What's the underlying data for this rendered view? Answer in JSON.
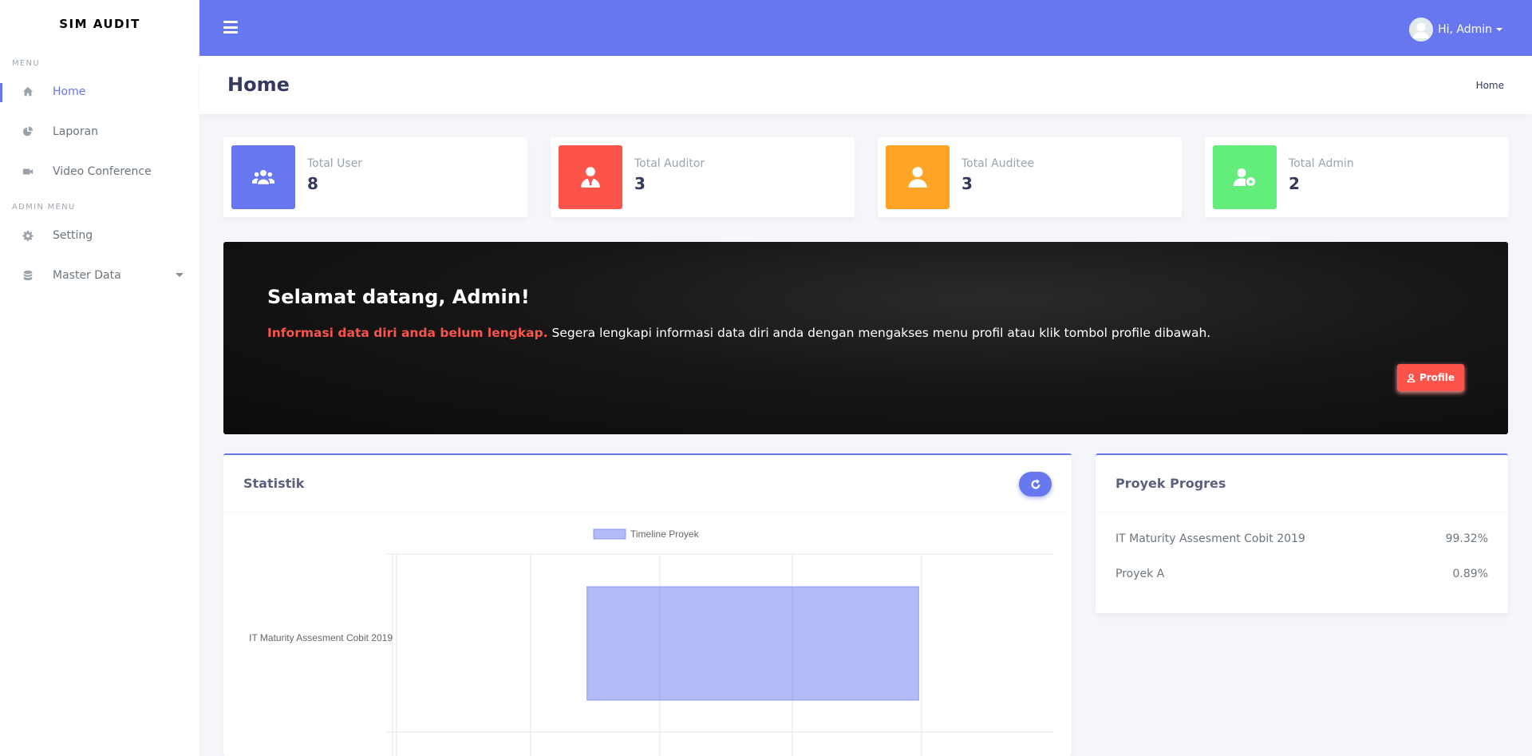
{
  "sidebar": {
    "brand": "SIM AUDIT",
    "menu_header": "MENU",
    "admin_menu_header": "ADMIN MENU",
    "items": [
      {
        "label": "Home",
        "icon": "home-icon"
      },
      {
        "label": "Laporan",
        "icon": "pie-chart-icon"
      },
      {
        "label": "Video Conference",
        "icon": "video-icon"
      },
      {
        "label": "Setting",
        "icon": "gear-icon"
      },
      {
        "label": "Master Data",
        "icon": "database-icon"
      }
    ]
  },
  "navbar": {
    "greeting": "Hi, Admin"
  },
  "section": {
    "title": "Home",
    "breadcrumb": "Home"
  },
  "stats": [
    {
      "label": "Total User",
      "value": "8",
      "color": "#6777ef",
      "icon": "users-icon"
    },
    {
      "label": "Total Auditor",
      "value": "3",
      "color": "#fc544b",
      "icon": "user-tie-icon"
    },
    {
      "label": "Total Auditee",
      "value": "3",
      "color": "#ffa426",
      "icon": "user-icon"
    },
    {
      "label": "Total Admin",
      "value": "2",
      "color": "#63ed7a",
      "icon": "user-cog-icon"
    }
  ],
  "hero": {
    "title": "Selamat datang, Admin!",
    "warning": "Informasi data diri anda belum lengkap.",
    "text": " Segera lengkapi informasi data diri anda dengan mengakses menu profil atau klik tombol profile dibawah.",
    "button_label": "Profile"
  },
  "statistik": {
    "title": "Statistik"
  },
  "chart_data": {
    "type": "bar",
    "orientation": "horizontal",
    "categories": [
      "IT Maturity Assesment Cobit 2019"
    ],
    "series": [
      {
        "name": "Timeline Proyek",
        "start_fraction": 0.29,
        "end_fraction": 0.795
      }
    ],
    "legend_position": "top",
    "grid": true
  },
  "proyek": {
    "title": "Proyek Progres",
    "items": [
      {
        "name": "IT Maturity Assesment Cobit 2019",
        "percent": "99.32%"
      },
      {
        "name": "Proyek A",
        "percent": "0.89%"
      }
    ]
  },
  "colors": {
    "primary": "#6777ef",
    "danger": "#fc544b",
    "warning": "#ffa426",
    "success": "#63ed7a",
    "bar_fill": "rgba(103,119,239,0.5)"
  }
}
